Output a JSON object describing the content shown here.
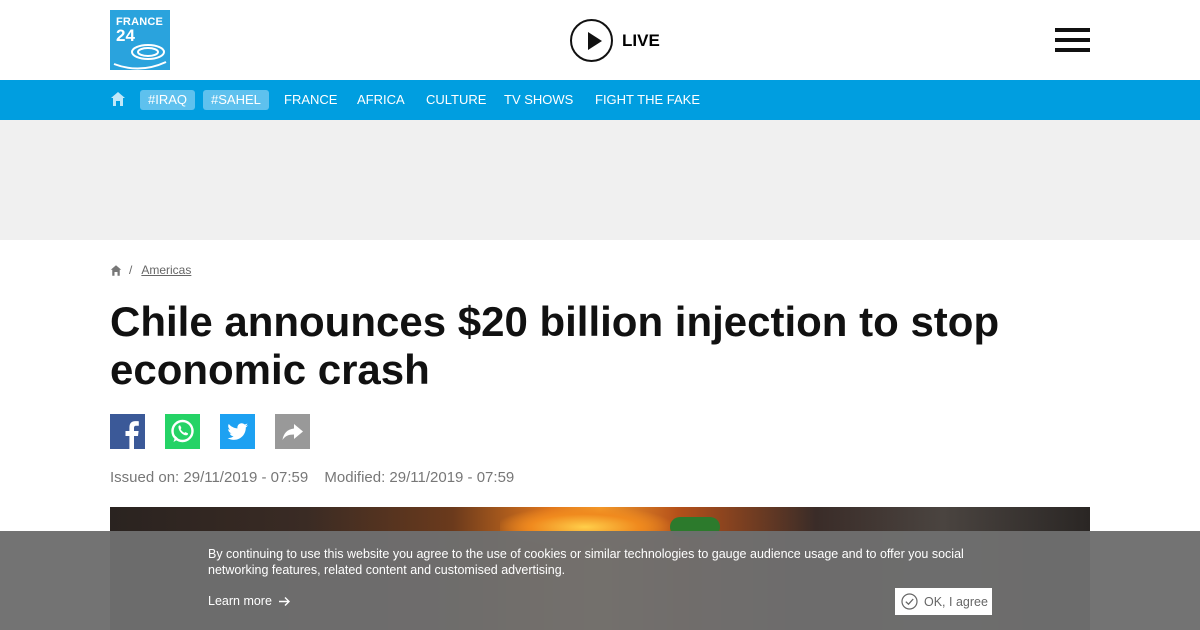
{
  "header": {
    "logo_line1": "FRANCE",
    "logo_line2": "24",
    "live_label": "LIVE"
  },
  "nav": {
    "tags": [
      "#IRAQ",
      "#SAHEL"
    ],
    "items": [
      "FRANCE",
      "AFRICA",
      "CULTURE",
      "TV SHOWS",
      "FIGHT THE FAKE"
    ]
  },
  "breadcrumb": {
    "separator": "/",
    "section": "Americas"
  },
  "article": {
    "title": "Chile announces $20 billion injection to stop economic crash",
    "issued": "Issued on: 29/11/2019 - 07:59",
    "modified": "Modified: 29/11/2019 - 07:59"
  },
  "share": {
    "icons": [
      "facebook-icon",
      "whatsapp-icon",
      "twitter-icon",
      "share-icon"
    ],
    "colors": {
      "facebook": "#3b5998",
      "whatsapp": "#25d366",
      "twitter": "#1da1f2",
      "share": "#999999"
    }
  },
  "cookie": {
    "message": "By continuing to use this website you agree to the use of cookies or similar technologies to gauge audience usage and to offer you social networking features, related content and customised advertising.",
    "learn_more": "Learn more",
    "agree": "OK, I agree"
  },
  "colors": {
    "brand": "#009ee0",
    "tag_bg": "#5ec1ee",
    "logo_bg": "#2aa3dd"
  }
}
